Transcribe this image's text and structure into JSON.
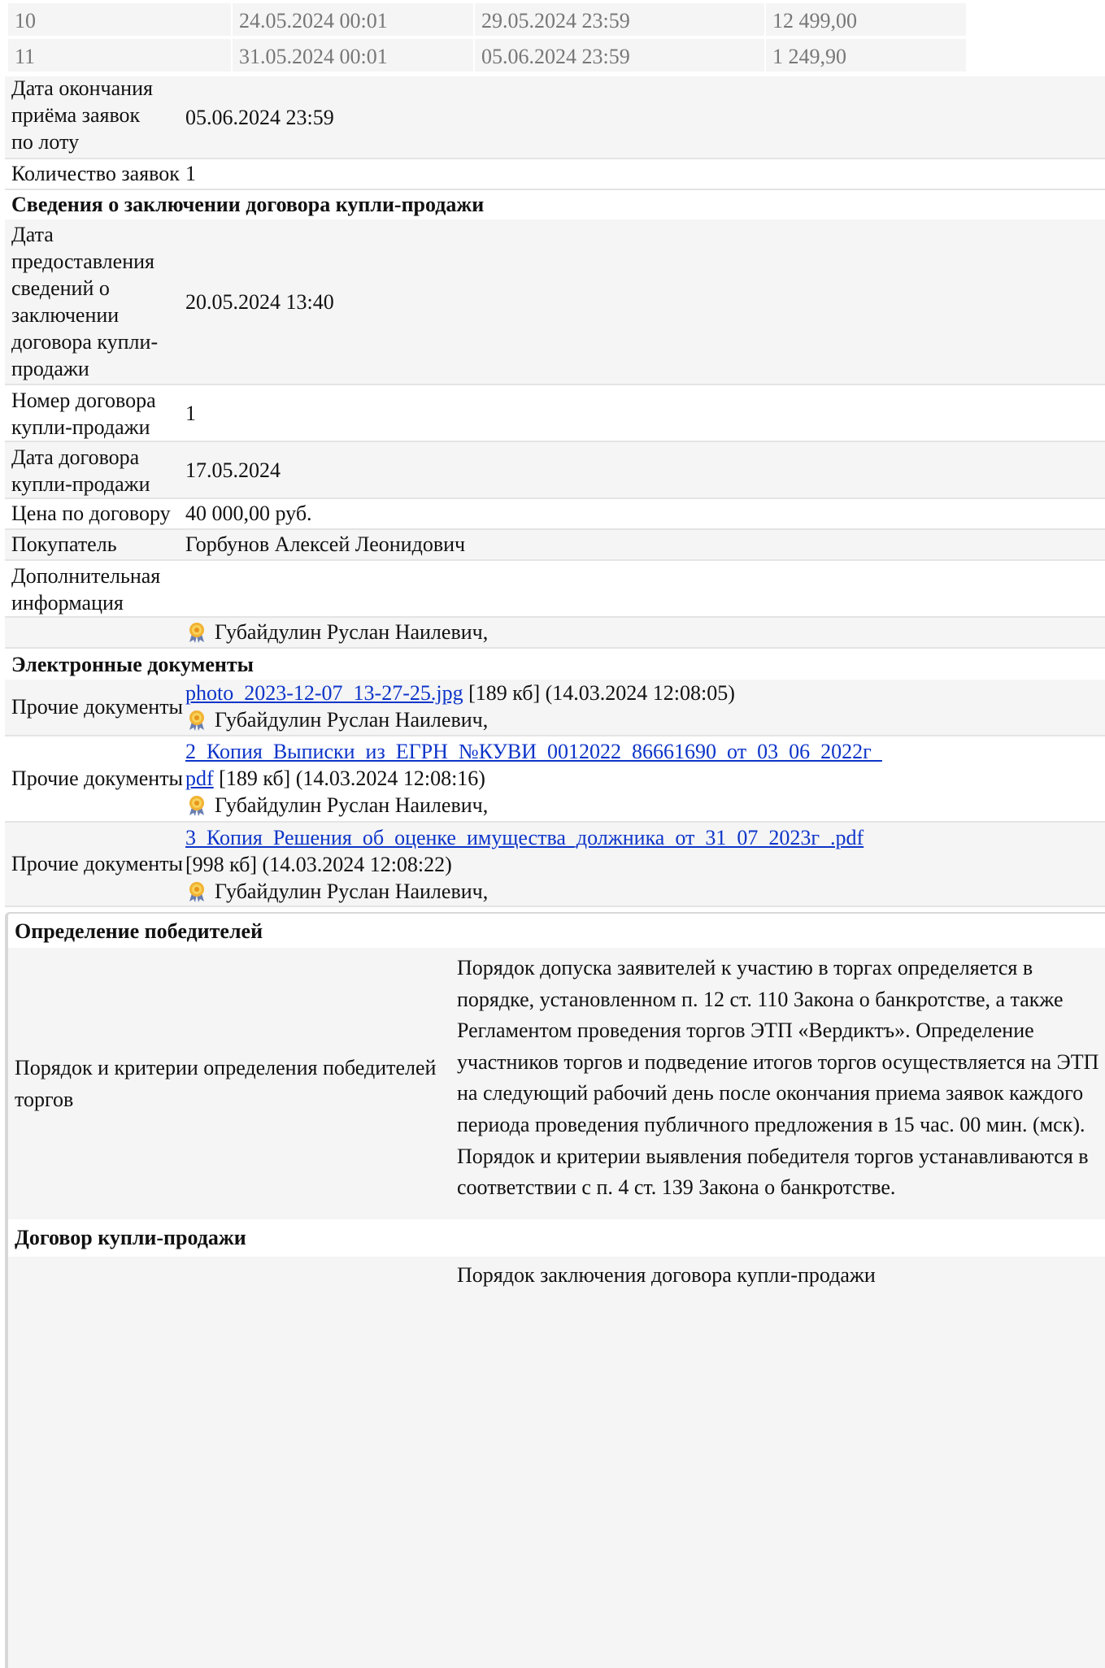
{
  "periods": [
    {
      "num": "10",
      "start": "24.05.2024 00:01",
      "end": "29.05.2024 23:59",
      "price": "12 499,00"
    },
    {
      "num": "11",
      "start": "31.05.2024 00:01",
      "end": "05.06.2024 23:59",
      "price": "1 249,90"
    }
  ],
  "lot": {
    "deadline_label": "Дата окончания приёма заявок по лоту",
    "deadline_value": "05.06.2024 23:59",
    "count_label": "Количество заявок",
    "count_value": "1"
  },
  "contract_section": {
    "title": "Сведения о заключении договора купли-продажи",
    "info_date_label": "Дата предоставления сведений о заключении договора купли-продажи",
    "info_date_value": "20.05.2024 13:40",
    "number_label": "Номер договора купли-продажи",
    "number_value": "1",
    "date_label": "Дата договора купли-продажи",
    "date_value": "17.05.2024",
    "price_label": "Цена по договору",
    "price_value": "40 000,00 руб.",
    "buyer_label": "Покупатель",
    "buyer_value": "Горбунов Алексей Леонидович",
    "extra_label": "Дополнительная информация",
    "extra_value": "",
    "signer": "Губайдулин Руслан Наилевич,"
  },
  "documents": {
    "title": "Электронные документы",
    "items": [
      {
        "label": "Прочие документы",
        "link": "photo_2023-12-07_13-27-25.jpg",
        "meta": " [189 кб] (14.03.2024 12:08:05)",
        "signer": "Губайдулин Руслан Наилевич,"
      },
      {
        "label": "Прочие документы",
        "link_line1": "2_Копия_Выписки_из_ЕГРН_№КУВИ_0012022_86661690_от_03_06_2022г_",
        "link_line2": "pdf",
        "meta": " [189 кб] (14.03.2024 12:08:16)",
        "signer": "Губайдулин Руслан Наилевич,"
      },
      {
        "label": "Прочие документы",
        "link": "3_Копия_Решения_об_оценке_имущества_должника_от_31_07_2023г_.pdf",
        "meta": "[998 кб] (14.03.2024 12:08:22)",
        "signer": "Губайдулин Руслан Наилевич,"
      }
    ]
  },
  "winners": {
    "title": "Определение победителей",
    "label": "Порядок и критерии определения победителей торгов",
    "value": "Порядок допуска заявителей к участию в торгах определяется в порядке, установленном п. 12 ст. 110 Закона о банкротстве, а также Регламентом проведения торгов ЭТП «Вердиктъ». Определение участников торгов и подведение итогов торгов осуществляется на ЭТП на следующий рабочий день после окончания приема заявок каждого периода проведения публичного предложения в 15 час. 00 мин. (мск). Порядок и критерии выявления победителя торгов устанавливаются в соответствии с п. 4 ст. 139 Закона о банкротстве."
  },
  "sale_contract": {
    "title": "Договор купли-продажи",
    "value_start": "Порядок заключения договора купли-продажи"
  },
  "colors": {
    "link": "#0d35c9",
    "muted": "#777777",
    "stripe": "#f5f5f5"
  },
  "icons": {
    "signer": "medal-icon"
  }
}
